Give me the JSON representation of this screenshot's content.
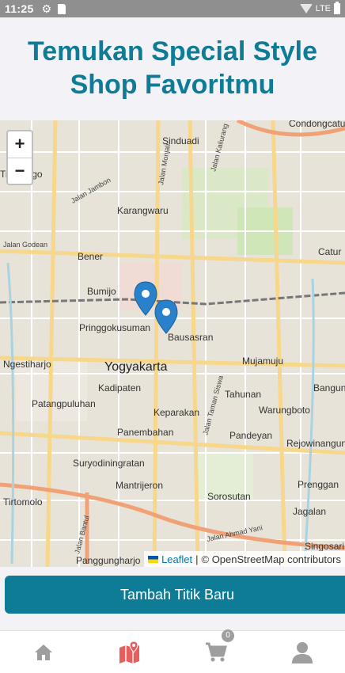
{
  "status_bar": {
    "time": "11:25",
    "network": "LTE"
  },
  "header": {
    "title_line1": "Temukan Special Style",
    "title_line2": "Shop Favoritmu"
  },
  "map": {
    "zoom_in": "+",
    "zoom_out": "−",
    "place_labels": {
      "condongcatur": "Condongcatur",
      "sinduadi": "Sinduadi",
      "trihanggo": "Trihanggo",
      "karangwaru": "Karangwaru",
      "jalan_monjali": "Jalan Monjali",
      "jalan_kaliurang": "Jalan Kaliurang",
      "jalan_jambon": "Jalan Jambon",
      "catur": "Catur",
      "jalan_godean": "Jalan Godean",
      "bener": "Bener",
      "bumijo": "Bumijo",
      "pringgokusuman": "Pringgokusuman",
      "bausasran": "Bausasran",
      "ngestiharjo": "Ngestiharjo",
      "yogyakarta": "Yogyakarta",
      "mujamuju": "Mujamuju",
      "kadipaten": "Kadipaten",
      "bangun": "Bangun",
      "tahunan": "Tahunan",
      "patangpuluhan": "Patangpuluhan",
      "warungboto": "Warungboto",
      "keparakan": "Keparakan",
      "jalan_taman_siswa": "Jalan Taman Siswa",
      "rejowinangun": "Rejowinangun",
      "panembahan": "Panembahan",
      "pandeyan": "Pandeyan",
      "suryodiningratan": "Suryodiningratan",
      "mantrijeron": "Mantrijeron",
      "prenggan": "Prenggan",
      "tirtomolo": "Tirtomolo",
      "sorosutan": "Sorosutan",
      "jagalan": "Jagalan",
      "jalan_bantul": "Jalan Bantul",
      "jalan_ahmad_yani": "Jalan Ahmad Yani",
      "singosari": "Singosari",
      "panggungharjo": "Panggungharjo"
    },
    "marker_color": "#2a81cb"
  },
  "attribution": {
    "leaflet": "Leaflet",
    "separator": "|",
    "osm": "© OpenStreetMap contributors"
  },
  "actions": {
    "add_point": "Tambah Titik Baru"
  },
  "bottom_nav": {
    "cart_count": "0",
    "active_color": "#e85d5d",
    "icons": [
      "home-icon",
      "map-icon",
      "cart-icon",
      "profile-icon"
    ]
  },
  "colors": {
    "primary": "#0e7c96"
  }
}
